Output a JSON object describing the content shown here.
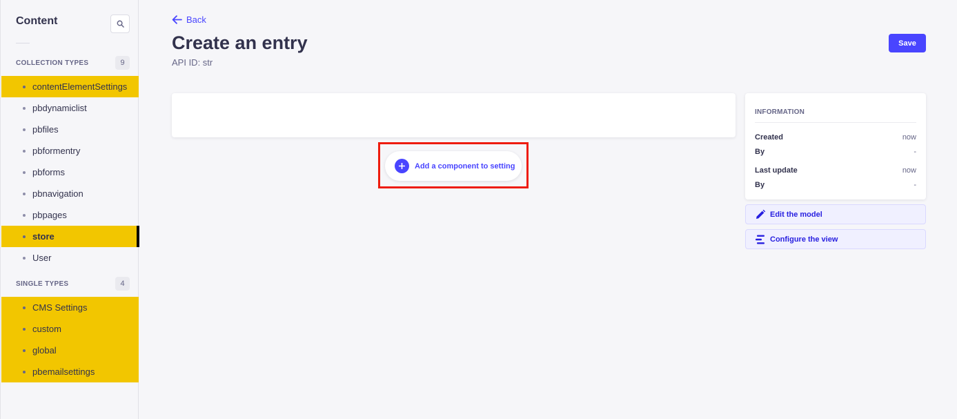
{
  "sidebar": {
    "title": "Content",
    "collection_types": {
      "label": "COLLECTION TYPES",
      "count": "9",
      "items": [
        {
          "label": "contentElementSettings"
        },
        {
          "label": "pbdynamiclist"
        },
        {
          "label": "pbfiles"
        },
        {
          "label": "pbformentry"
        },
        {
          "label": "pbforms"
        },
        {
          "label": "pbnavigation"
        },
        {
          "label": "pbpages"
        },
        {
          "label": "store"
        },
        {
          "label": "User"
        }
      ]
    },
    "single_types": {
      "label": "SINGLE TYPES",
      "count": "4",
      "items": [
        {
          "label": "CMS Settings"
        },
        {
          "label": "custom"
        },
        {
          "label": "global"
        },
        {
          "label": "pbemailsettings"
        }
      ]
    }
  },
  "header": {
    "back_label": "Back",
    "title": "Create an entry",
    "api_id": "API ID: str",
    "save_label": "Save"
  },
  "main": {
    "add_component_label": "Add a component to setting"
  },
  "info": {
    "title": "INFORMATION",
    "created_label": "Created",
    "created_value": "now",
    "created_by_label": "By",
    "created_by_value": "-",
    "updated_label": "Last update",
    "updated_value": "now",
    "updated_by_label": "By",
    "updated_by_value": "-"
  },
  "actions": {
    "edit_model_label": "Edit the model",
    "configure_view_label": "Configure the view"
  },
  "colors": {
    "accent": "#4945ff",
    "highlight": "#f2c600",
    "annotation": "#ee1c0e"
  }
}
